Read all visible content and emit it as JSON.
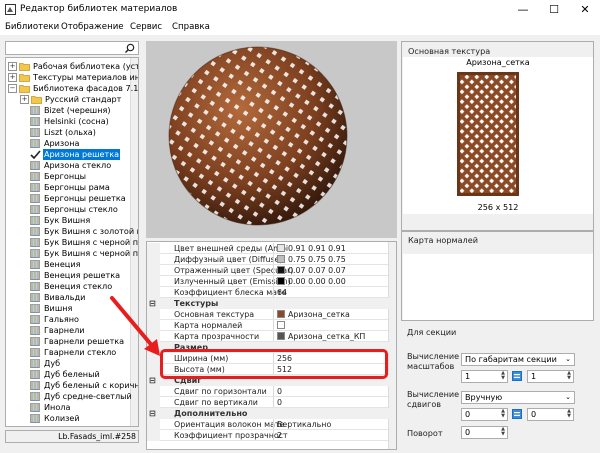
{
  "window": {
    "title": "Редактор библиотек материалов",
    "controls": [
      "—",
      "☐",
      "✕"
    ]
  },
  "menu": [
    "Библиотеки",
    "Отображение",
    "Сервис",
    "Справка"
  ],
  "tree": {
    "search_value": "",
    "items": [
      {
        "label": "Рабочая библиотека (устаре",
        "kind": "folder-closed",
        "level": 0,
        "expandable": true
      },
      {
        "label": "Текстуры материалов интер",
        "kind": "folder-closed",
        "level": 0,
        "expandable": true
      },
      {
        "label": "Библиотека фасадов 7.1",
        "kind": "folder-open",
        "level": 0,
        "expandable": true
      },
      {
        "label": "Русский стандарт",
        "kind": "folder-closed",
        "level": 1,
        "expandable": true
      },
      {
        "label": "Bizet (черешня)",
        "kind": "material",
        "level": 1
      },
      {
        "label": "Helsinki (сосна)",
        "kind": "material",
        "level": 1
      },
      {
        "label": "Liszt (ольха)",
        "kind": "material",
        "level": 1
      },
      {
        "label": "Аризона",
        "kind": "material",
        "level": 1
      },
      {
        "label": "Аризона решетка",
        "kind": "checked",
        "level": 1,
        "selected": true
      },
      {
        "label": "Аризона стекло",
        "kind": "material",
        "level": 1
      },
      {
        "label": "Бергонцы",
        "kind": "material",
        "level": 1
      },
      {
        "label": "Бергонцы рама",
        "kind": "material",
        "level": 1
      },
      {
        "label": "Бергонцы решетка",
        "kind": "material",
        "level": 1
      },
      {
        "label": "Бергонцы стекло",
        "kind": "material",
        "level": 1
      },
      {
        "label": "Бук Вишня",
        "kind": "material",
        "level": 1
      },
      {
        "label": "Бук Вишня с золотой пати",
        "kind": "material",
        "level": 1
      },
      {
        "label": "Бук Вишня с черной пати",
        "kind": "material",
        "level": 1
      },
      {
        "label": "Бук Вишня с черной пати",
        "kind": "material",
        "level": 1
      },
      {
        "label": "Венеция",
        "kind": "material",
        "level": 1
      },
      {
        "label": "Венеция решетка",
        "kind": "material",
        "level": 1
      },
      {
        "label": "Венеция стекло",
        "kind": "material",
        "level": 1
      },
      {
        "label": "Вивальди",
        "kind": "material",
        "level": 1
      },
      {
        "label": "Вишня",
        "kind": "material",
        "level": 1
      },
      {
        "label": "Гальяно",
        "kind": "material",
        "level": 1
      },
      {
        "label": "Гварнели",
        "kind": "material",
        "level": 1
      },
      {
        "label": "Гварнели решетка",
        "kind": "material",
        "level": 1
      },
      {
        "label": "Гварнели стекло",
        "kind": "material",
        "level": 1
      },
      {
        "label": "Дуб",
        "kind": "material",
        "level": 1
      },
      {
        "label": "Дуб беленый",
        "kind": "material",
        "level": 1
      },
      {
        "label": "Дуб беленый с коричневой",
        "kind": "material",
        "level": 1
      },
      {
        "label": "Дуб средне-светлый",
        "kind": "material",
        "level": 1
      },
      {
        "label": "Инола",
        "kind": "material",
        "level": 1
      },
      {
        "label": "Колизей",
        "kind": "material",
        "level": 1
      }
    ],
    "status": "Lb.Fasads_iml.#258"
  },
  "properties": {
    "rows": [
      {
        "type": "prop",
        "name": "Цвет внешней среды (Ambi",
        "value": "0.91 0.91 0.91",
        "swatch": "#e8e8e8"
      },
      {
        "type": "prop",
        "name": "Диффузный цвет (Diffuse)",
        "value": "0.75 0.75 0.75",
        "swatch": "#bfbfbf"
      },
      {
        "type": "prop",
        "name": "Отраженный цвет (Specular)",
        "value": "0.07 0.07 0.07",
        "swatch": "#121212"
      },
      {
        "type": "prop",
        "name": "Излученный цвет (Emission)",
        "value": "0.00 0.00 0.00",
        "swatch": "#000000"
      },
      {
        "type": "prop",
        "name": "Коэффициент блеска мате",
        "value": "64"
      },
      {
        "type": "cat",
        "name": "Текстуры"
      },
      {
        "type": "prop",
        "name": "Основная текстура",
        "value": "Аризона_сетка",
        "swatch": "#8a4a2a"
      },
      {
        "type": "prop",
        "name": "Карта нормалей",
        "value": "",
        "swatch": "#ffffff"
      },
      {
        "type": "prop",
        "name": "Карта прозрачности",
        "value": "Аризона_сетка_КП",
        "swatch": "#555555"
      },
      {
        "type": "cat",
        "name": "Размер"
      },
      {
        "type": "prop",
        "name": "Ширина (мм)",
        "value": "256"
      },
      {
        "type": "prop",
        "name": "Высота (мм)",
        "value": "512"
      },
      {
        "type": "cat",
        "name": "Сдвиг"
      },
      {
        "type": "prop",
        "name": "Сдвиг по горизонтали",
        "value": "0"
      },
      {
        "type": "prop",
        "name": "Сдвиг по вертикали",
        "value": "0"
      },
      {
        "type": "cat",
        "name": "Дополнительно"
      },
      {
        "type": "prop",
        "name": "Ориентация волокон мате",
        "value": "Вертикально"
      },
      {
        "type": "prop",
        "name": "Коэффициент прозрачност",
        "value": "2"
      }
    ]
  },
  "texture_panel": {
    "title": "Основная текстура",
    "name": "Аризона_сетка",
    "size": "256 x 512"
  },
  "normals_panel": {
    "title": "Карта нормалей"
  },
  "section_panel": {
    "title": "Для секции",
    "scale_label": "Вычисление масштабов",
    "scale_mode": "По габаритам секции",
    "scale_x": "1",
    "scale_y": "1",
    "shift_label": "Вычисление сдвигов",
    "shift_mode": "Вручную",
    "shift_x": "0",
    "shift_y": "0",
    "rotate_label": "Поворот",
    "rotate_value": "0"
  },
  "colors": {
    "selection": "#0078d7",
    "wood": "#8b4a26",
    "highlight": "#e81d1d",
    "arrow": "#e81d1d"
  }
}
